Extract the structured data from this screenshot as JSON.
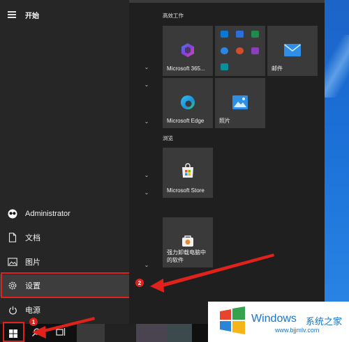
{
  "start_menu": {
    "title": "开始",
    "left_items": [
      {
        "label": "Administrator",
        "icon": "user-avatar-icon"
      },
      {
        "label": "文档",
        "icon": "document-icon"
      },
      {
        "label": "图片",
        "icon": "pictures-icon"
      },
      {
        "label": "设置",
        "icon": "gear-icon"
      },
      {
        "label": "电源",
        "icon": "power-icon"
      }
    ]
  },
  "groups": [
    {
      "title": "高效工作"
    },
    {
      "title": "浏览"
    }
  ],
  "tiles": {
    "m365": "Microsoft 365...",
    "mail": "邮件",
    "edge": "Microsoft Edge",
    "photos": "照片",
    "store": "Microsoft Store",
    "uninstaller": "强力卸载电脑中的软件"
  },
  "annotations": {
    "badge1": "1",
    "badge2": "2",
    "highlight_color": "#e1221c"
  },
  "watermark": {
    "brand": "Windows",
    "cn": "系统之家",
    "url": "www.bjjmlv.com"
  }
}
